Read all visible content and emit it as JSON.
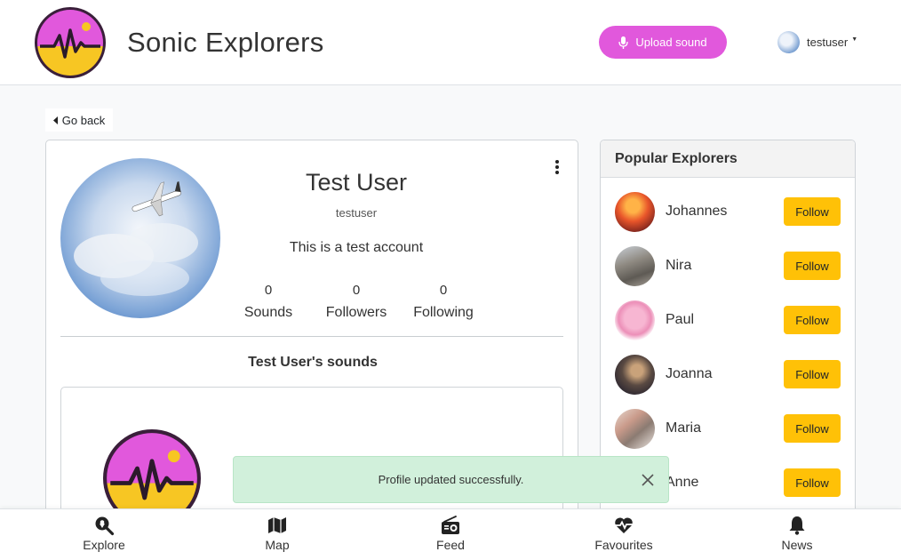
{
  "header": {
    "app_title": "Sonic Explorers",
    "upload_label": "Upload sound",
    "username": "testuser",
    "brand_pink": "#e158dc"
  },
  "nav": {
    "go_back": "Go back"
  },
  "profile": {
    "display_name": "Test User",
    "username": "testuser",
    "bio": "This is a test account",
    "stats": [
      {
        "value": "0",
        "label": "Sounds"
      },
      {
        "value": "0",
        "label": "Followers"
      },
      {
        "value": "0",
        "label": "Following"
      }
    ],
    "sounds_heading": "Test User's sounds"
  },
  "sidebar": {
    "title": "Popular Explorers",
    "follow_label": "Follow",
    "explorers": [
      {
        "name": "Johannes"
      },
      {
        "name": "Nira"
      },
      {
        "name": "Paul"
      },
      {
        "name": "Joanna"
      },
      {
        "name": "Maria"
      },
      {
        "name": "Anne"
      }
    ]
  },
  "toast": {
    "message": "Profile updated successfully."
  },
  "bottom_nav": [
    {
      "label": "Explore",
      "icon": "search-location-icon"
    },
    {
      "label": "Map",
      "icon": "map-icon"
    },
    {
      "label": "Feed",
      "icon": "radio-icon"
    },
    {
      "label": "Favourites",
      "icon": "heartbeat-icon"
    },
    {
      "label": "News",
      "icon": "bell-icon"
    }
  ],
  "colors": {
    "follow": "#ffc107",
    "toast_bg": "#d1f0db",
    "accent": "#e158dc"
  }
}
